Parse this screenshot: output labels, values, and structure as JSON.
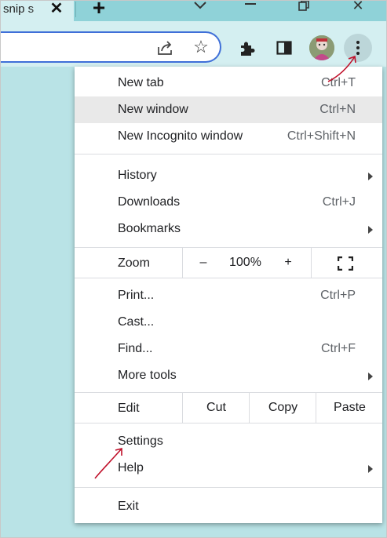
{
  "browser": {
    "tab": {
      "title": "snip s",
      "close_glyph": "✕"
    },
    "new_tab_glyph": "+",
    "window_controls": {
      "close_glyph": "✕"
    },
    "toolbar": {
      "star_glyph": "☆"
    }
  },
  "menu": {
    "new_tab": {
      "label": "New tab",
      "shortcut": "Ctrl+T"
    },
    "new_window": {
      "label": "New window",
      "shortcut": "Ctrl+N"
    },
    "new_incognito": {
      "label": "New Incognito window",
      "shortcut": "Ctrl+Shift+N"
    },
    "history": {
      "label": "History"
    },
    "downloads": {
      "label": "Downloads",
      "shortcut": "Ctrl+J"
    },
    "bookmarks": {
      "label": "Bookmarks"
    },
    "zoom": {
      "label": "Zoom",
      "minus": "–",
      "value": "100%",
      "plus": "+"
    },
    "print": {
      "label": "Print...",
      "shortcut": "Ctrl+P"
    },
    "cast": {
      "label": "Cast..."
    },
    "find": {
      "label": "Find...",
      "shortcut": "Ctrl+F"
    },
    "more_tools": {
      "label": "More tools"
    },
    "edit": {
      "label": "Edit",
      "cut": "Cut",
      "copy": "Copy",
      "paste": "Paste"
    },
    "settings": {
      "label": "Settings"
    },
    "help": {
      "label": "Help"
    },
    "exit": {
      "label": "Exit"
    }
  },
  "colors": {
    "page_background": "#b9e3e6",
    "tab_strip": "#8fd2d8",
    "toolbar": "#d4eff1",
    "omnibox_focus_ring": "#3f6fd8",
    "menu_highlight": "#e9e9e9",
    "annotation_arrow": "#c0102a"
  }
}
